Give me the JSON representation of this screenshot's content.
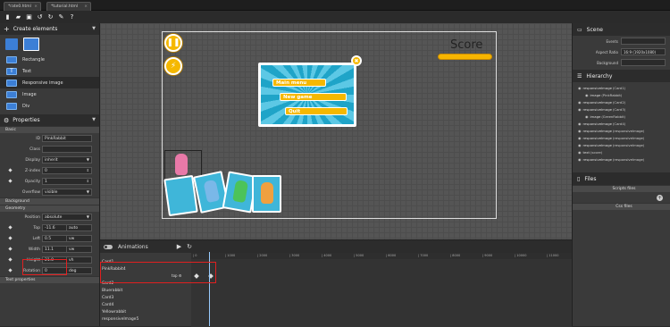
{
  "tabs": [
    {
      "label": "*rate0.html"
    },
    {
      "label": "*tutorial.html"
    }
  ],
  "toolbar": {
    "icons": [
      "new-file-icon",
      "open-folder-icon",
      "save-icon",
      "undo-icon",
      "redo-icon",
      "magic-wand-icon",
      "help-icon"
    ]
  },
  "left": {
    "create_title": "Create elements",
    "elements": [
      {
        "label": "Rectangle"
      },
      {
        "label": "Text"
      },
      {
        "label": "Responsive image"
      },
      {
        "label": "Image"
      },
      {
        "label": "Div"
      }
    ],
    "properties_title": "Properties",
    "basic_title": "Basic",
    "basic": [
      {
        "label": "ID",
        "value": "PinkRabbit"
      },
      {
        "label": "Class",
        "value": ""
      },
      {
        "label": "Display",
        "value": "inherit"
      },
      {
        "label": "Z-index",
        "value": "0"
      },
      {
        "label": "Opacity",
        "value": "1"
      },
      {
        "label": "Overflow",
        "value": "visible"
      }
    ],
    "background_title": "Background",
    "geometry_title": "Geometry",
    "geometry": [
      {
        "label": "Position",
        "value": "absolute",
        "unit": ""
      },
      {
        "label": "Top",
        "value": "-11.6",
        "unit": "auto"
      },
      {
        "label": "Left",
        "value": "0.5",
        "unit": "vw"
      },
      {
        "label": "Width",
        "value": "11.1",
        "unit": "vw"
      },
      {
        "label": "Height",
        "value": "21.0",
        "unit": "vh"
      },
      {
        "label": "Rotation",
        "value": "0",
        "unit": "deg"
      }
    ],
    "more_title": "Text properties"
  },
  "canvas": {
    "score_label": "Score",
    "menu": [
      "Main menu",
      "New game",
      "Quit"
    ]
  },
  "right": {
    "scene_title": "Scene",
    "scene": [
      {
        "label": "Events",
        "value": ""
      },
      {
        "label": "Aspect Ratio",
        "value": "16:9 (1920x1080)"
      },
      {
        "label": "Background",
        "value": ""
      }
    ],
    "hierarchy_title": "Hierarchy",
    "hierarchy": [
      {
        "name": "responsiveImage",
        "tag": "(Card1)"
      },
      {
        "name": "image",
        "tag": "(PinkRabbit)"
      },
      {
        "name": "responsiveImage",
        "tag": "(Card2)"
      },
      {
        "name": "responsiveImage",
        "tag": "(Card3)"
      },
      {
        "name": "image",
        "tag": "(GreenRabbit)"
      },
      {
        "name": "responsiveImage",
        "tag": "(Card4)"
      },
      {
        "name": "responsiveImage",
        "tag": "(responsiveImage)"
      },
      {
        "name": "responsiveImage",
        "tag": "(responsiveImage)"
      },
      {
        "name": "responsiveImage",
        "tag": "(responsiveImage)"
      },
      {
        "name": "text",
        "tag": "(score)"
      },
      {
        "name": "responsiveImage",
        "tag": "(responsiveImage)"
      }
    ],
    "files_title": "Files",
    "script_files": "Scripts files",
    "css_files": "Css files"
  },
  "timeline": {
    "title": "Animations",
    "ticks": [
      "0",
      "1000",
      "2000",
      "3000",
      "4000",
      "5000",
      "6000",
      "7000",
      "8000",
      "9000",
      "10000",
      "11000"
    ],
    "tracks": [
      "Card1",
      "PinkRabbit4",
      "",
      "",
      "Card2",
      "Bluerabbit",
      "Card3",
      "Card4",
      "Yellowrabbit",
      "responsiveImage5"
    ],
    "key_label": "top"
  },
  "colors": {
    "accent": "#3c7fd6",
    "highlight": "#e02020",
    "gold": "#f5b800"
  }
}
